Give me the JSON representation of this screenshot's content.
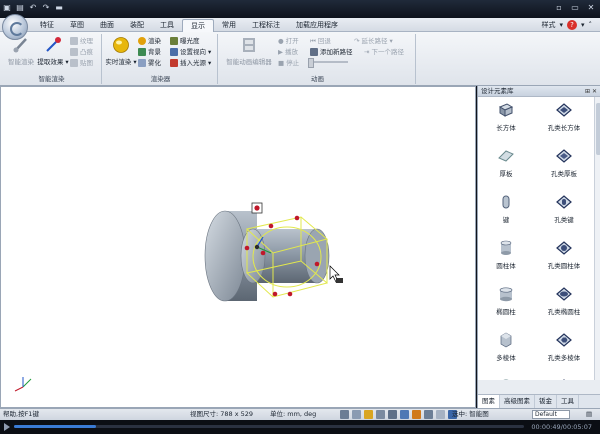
{
  "ribbon_tabs": [
    "特征",
    "草图",
    "曲面",
    "装配",
    "工具",
    "显示",
    "常用",
    "工程标注",
    "加载应用程序"
  ],
  "active_tab": "显示",
  "style_label": "样式",
  "help_label": "?",
  "groups": {
    "smart_render": {
      "title": "智能渲染",
      "big": [
        "智能渲染",
        "提取效果"
      ],
      "small": [
        "纹理",
        "凸痕",
        "贴图"
      ]
    },
    "renderer": {
      "title": "渲染器",
      "big": [
        "实时渲染"
      ],
      "small": [
        "渲染",
        "曝光度",
        "背景",
        "设置视向",
        "雾化",
        "插入光源"
      ]
    },
    "animation": {
      "title": "动画",
      "big": [
        "智能动画编辑器"
      ],
      "small": [
        "打开",
        "回退",
        "延长路径",
        "播放",
        "添加新路径",
        "下一个路径",
        "停止"
      ]
    }
  },
  "panel": {
    "title": "设计元素库",
    "items": [
      "长方体",
      "孔类长方体",
      "厚板",
      "孔类厚板",
      "键",
      "孔类键",
      "圆柱体",
      "孔类圆柱体",
      "椭圆柱",
      "孔类椭圆柱",
      "多棱体",
      "孔类多棱体"
    ],
    "tabs": [
      "图素",
      "高级图素",
      "钣金",
      "工具"
    ],
    "active_tab": "图素"
  },
  "status": {
    "hint": "帮助,按F1键",
    "view_size_label": "视图尺寸: 788 x 529",
    "units_label": "单位: mm, deg",
    "selection_label": "选中: 智能图",
    "scheme": "Default"
  },
  "video": {
    "time": "00:00:49/00:05:07",
    "progress": 0.16
  },
  "colors": {
    "accent": "#3a7bd5",
    "part_body": "#8e9aa7",
    "selection_box": "#e2e84d",
    "handle": "#c0182a"
  }
}
